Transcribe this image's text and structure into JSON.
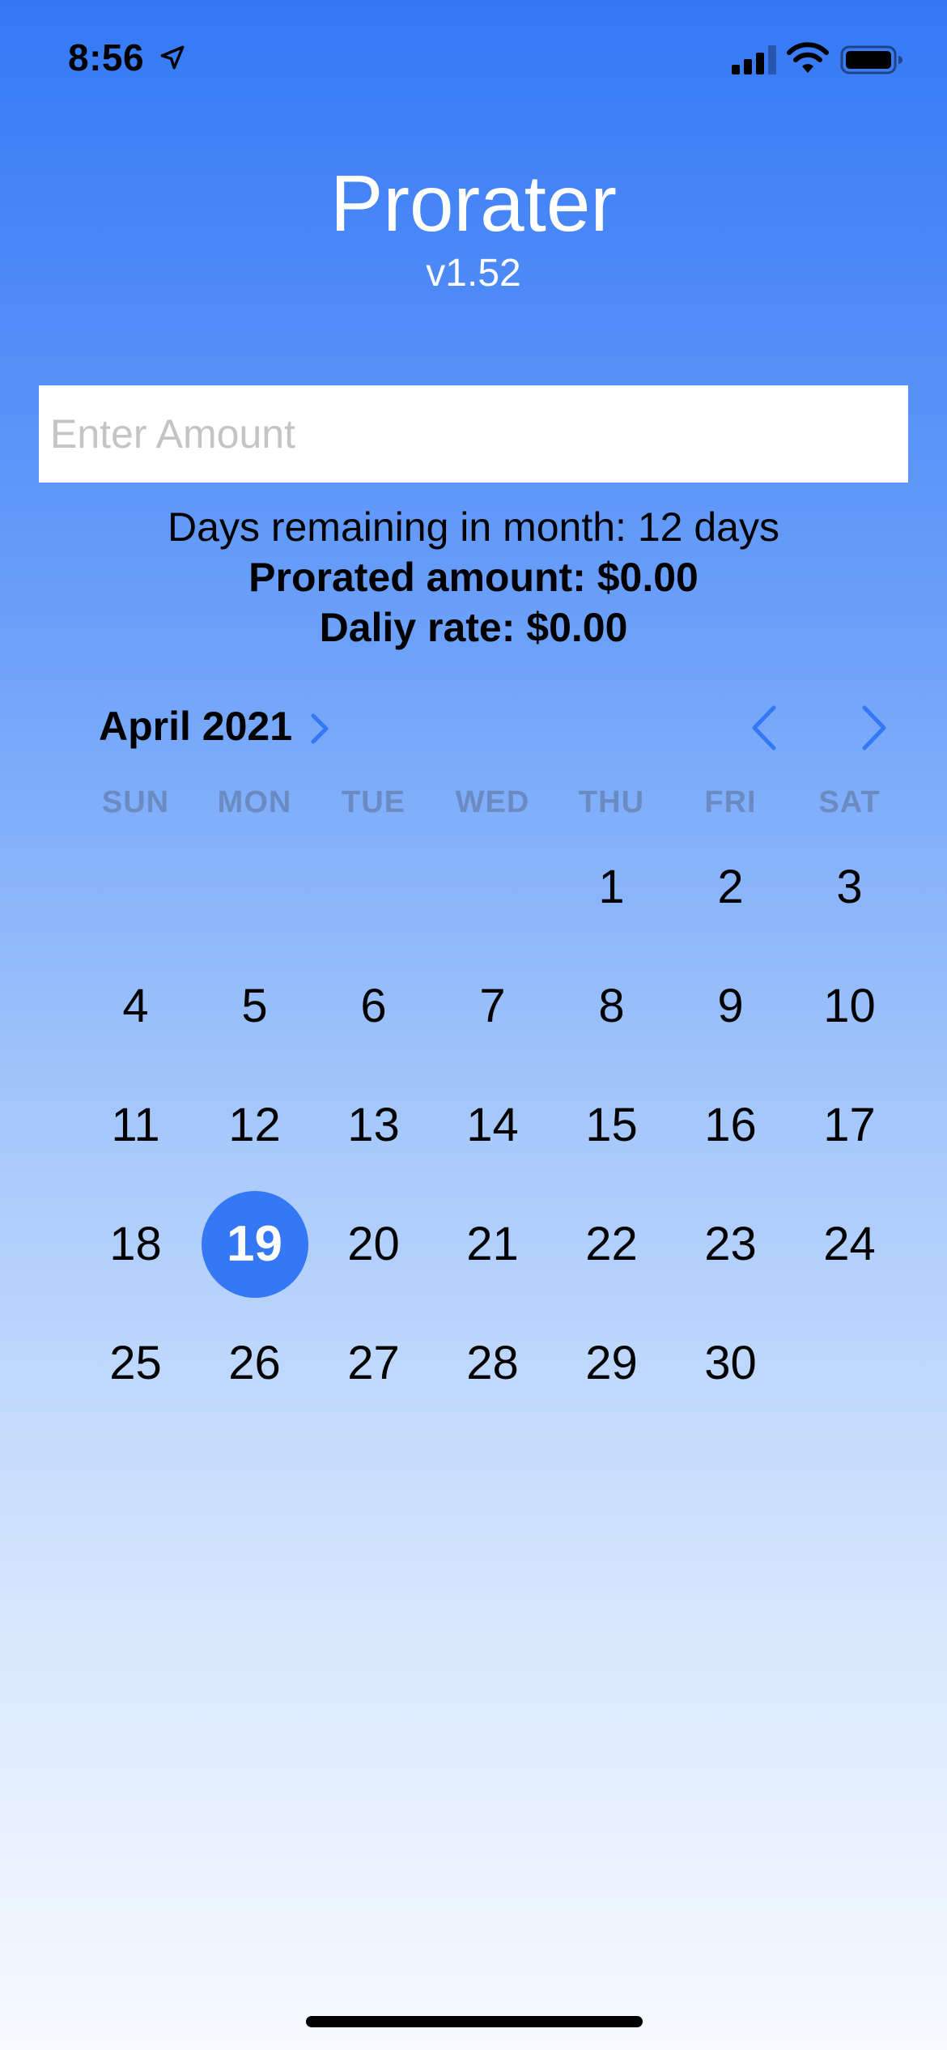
{
  "status_bar": {
    "time": "8:56",
    "icons": [
      "location-arrow-icon",
      "cellular-signal-icon",
      "wifi-icon",
      "battery-icon"
    ]
  },
  "app": {
    "title": "Prorater",
    "version": "v1.52"
  },
  "amount_input": {
    "placeholder": "Enter Amount",
    "value": ""
  },
  "summary": {
    "days_remaining": "Days remaining in month: 12 days",
    "prorated_amount": "Prorated amount: $0.00",
    "daily_rate": "Daliy rate: $0.00"
  },
  "calendar": {
    "month_label": "April 2021",
    "weekdays": [
      "SUN",
      "MON",
      "TUE",
      "WED",
      "THU",
      "FRI",
      "SAT"
    ],
    "selected_day": "19",
    "weeks": [
      [
        "",
        "",
        "",
        "",
        "1",
        "2",
        "3"
      ],
      [
        "4",
        "5",
        "6",
        "7",
        "8",
        "9",
        "10"
      ],
      [
        "11",
        "12",
        "13",
        "14",
        "15",
        "16",
        "17"
      ],
      [
        "18",
        "19",
        "20",
        "21",
        "22",
        "23",
        "24"
      ],
      [
        "25",
        "26",
        "27",
        "28",
        "29",
        "30",
        ""
      ]
    ]
  },
  "colors": {
    "accent": "#3478f6",
    "gradient_top": "#3478f6",
    "gradient_bottom": "#f7faff",
    "weekday_label": "#9aa7bd"
  }
}
